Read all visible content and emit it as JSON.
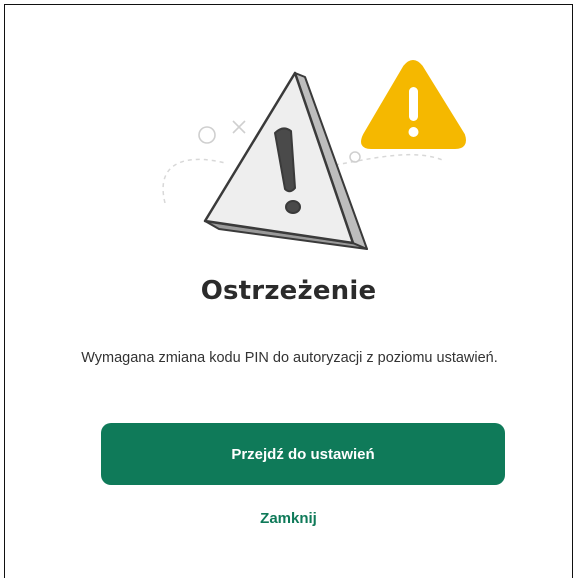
{
  "dialog": {
    "title": "Ostrzeżenie",
    "message": "Wymagana zmiana kodu PIN do autoryzacji z poziomu ustawień.",
    "primary_button_label": "Przejdź do ustawień",
    "close_link_label": "Zamknij"
  },
  "icons": {
    "illustration": "warning-triangle-icon",
    "badge": "warning-badge-icon"
  },
  "colors": {
    "accent": "#0f7a59",
    "warning": "#f5b800",
    "title": "#2b2b2b",
    "text": "#333333"
  }
}
